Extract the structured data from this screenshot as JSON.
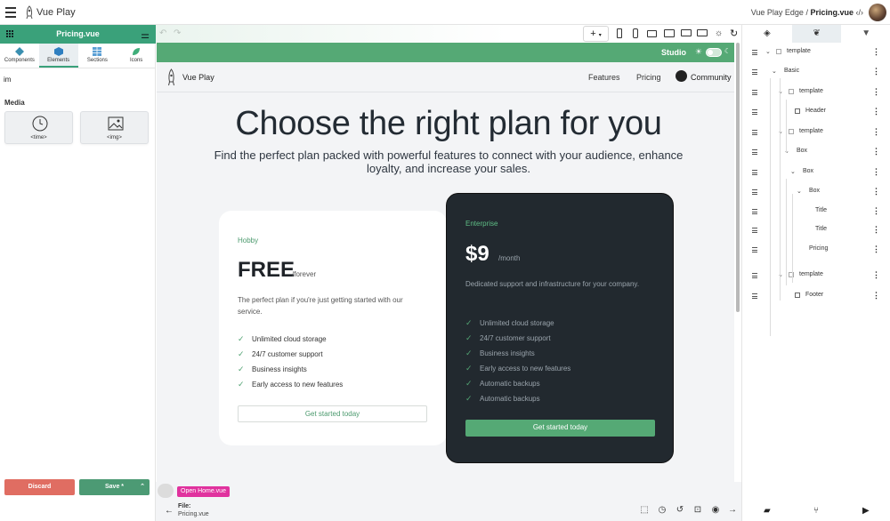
{
  "app": {
    "name": "Vue Play",
    "breadcrumb_root": "Vue Play Edge",
    "breadcrumb_sep": " / ",
    "breadcrumb_file": "Pricing.vue"
  },
  "left": {
    "file_title": "Pricing.vue",
    "tabs": [
      {
        "label": "Components"
      },
      {
        "label": "Elements"
      },
      {
        "label": "Sections"
      },
      {
        "label": "Icons"
      }
    ],
    "search_value": "im",
    "section": "Media",
    "items": [
      {
        "label": "<time>",
        "icon": "clock-icon"
      },
      {
        "label": "<img>",
        "icon": "image-icon"
      }
    ],
    "discard_label": "Discard",
    "save_label": "Save *"
  },
  "studio": {
    "label": "Studio"
  },
  "site": {
    "brand": "Vue Play",
    "nav": [
      "Features",
      "Pricing",
      "Community"
    ],
    "heading": "Choose the right plan for you",
    "subheading": "Find the perfect plan packed with powerful features to connect with your audience, enhance loyalty, and increase your sales.",
    "plans": [
      {
        "name": "Hobby",
        "price": "FREE",
        "period": "/forever",
        "desc": "The perfect plan if you're just getting started with our service.",
        "features": [
          "Unlimited cloud storage",
          "24/7 customer support",
          "Business insights",
          "Early access to new features"
        ],
        "cta": "Get started today"
      },
      {
        "name": "Enterprise",
        "price": "$9",
        "period": "/month",
        "desc": "Dedicated support and infrastructure for your company.",
        "features": [
          "Unlimited cloud storage",
          "24/7 customer support",
          "Business insights",
          "Early access to new features",
          "Automatic backups",
          "Automatic backups"
        ],
        "cta": "Get started today"
      }
    ]
  },
  "bottom": {
    "open_home": "Open Home.vue",
    "file_label": "File:",
    "file_name": "Pricing.vue"
  },
  "tree": [
    {
      "name": "template",
      "depth": 0,
      "caret": true,
      "checkbox": true
    },
    {
      "name": "Basic",
      "depth": 1,
      "caret": true,
      "checkbox": false
    },
    {
      "name": "template",
      "depth": 2,
      "caret": true,
      "checkbox": true
    },
    {
      "name": "Header",
      "depth": 3,
      "caret": false,
      "checkbox": false,
      "icon": true
    },
    {
      "name": "template",
      "depth": 2,
      "caret": true,
      "checkbox": true
    },
    {
      "name": "Box",
      "depth": 3,
      "caret": true,
      "checkbox": false
    },
    {
      "name": "Box",
      "depth": 4,
      "caret": true,
      "checkbox": false
    },
    {
      "name": "Box",
      "depth": 5,
      "caret": true,
      "checkbox": false
    },
    {
      "name": "Title",
      "depth": 6,
      "caret": false,
      "checkbox": false
    },
    {
      "name": "Title",
      "depth": 6,
      "caret": false,
      "checkbox": false
    },
    {
      "name": "Pricing",
      "depth": 5,
      "caret": false,
      "checkbox": false
    },
    {
      "name": "template",
      "depth": 2,
      "caret": true,
      "checkbox": true
    },
    {
      "name": "Footer",
      "depth": 3,
      "caret": false,
      "checkbox": false,
      "icon": true
    }
  ],
  "colors": {
    "accent": "#3aa17a",
    "studio": "#55a975",
    "dark_card": "#22292f",
    "discard": "#e06d62",
    "save": "#4c9a74",
    "pink": "#e0329e"
  }
}
